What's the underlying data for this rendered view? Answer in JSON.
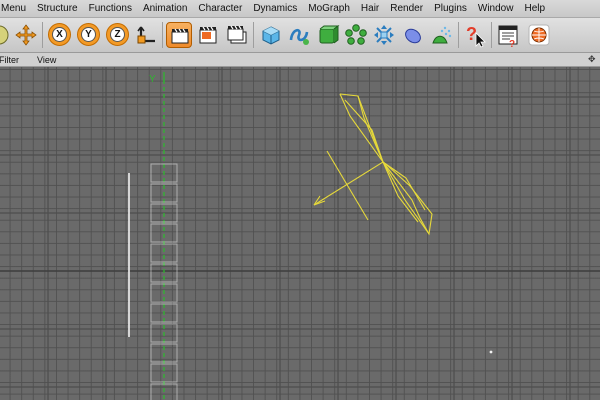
{
  "menubar": {
    "items": [
      "Menu",
      "Structure",
      "Functions",
      "Animation",
      "Character",
      "Dynamics",
      "MoGraph",
      "Hair",
      "Render",
      "Plugins",
      "Window",
      "Help"
    ]
  },
  "toolbar": {
    "axis_x": "X",
    "axis_y": "Y",
    "axis_z": "Z",
    "icons": [
      "move-icon",
      "x-axis-lock-icon",
      "y-axis-lock-icon",
      "z-axis-lock-icon",
      "coordinate-system-icon",
      "render-view-icon",
      "render-picture-viewer-icon",
      "render-settings-icon",
      "cube-primitive-icon",
      "spline-icon",
      "nurbs-icon",
      "array-icon",
      "deformer-icon",
      "scene-object-icon",
      "environment-icon",
      "help-icon",
      "layout-icon",
      "web-icon"
    ]
  },
  "viewport_menu": {
    "items": [
      "Filter",
      "View"
    ]
  },
  "viewport": {
    "axis_label": "Y",
    "colors": {
      "grid_bg": "#6a6a6a",
      "grid_line": "#505050",
      "y_axis": "#2fb52f",
      "wireframe": "#e6d93a",
      "spline": "#f2f2f2"
    }
  }
}
